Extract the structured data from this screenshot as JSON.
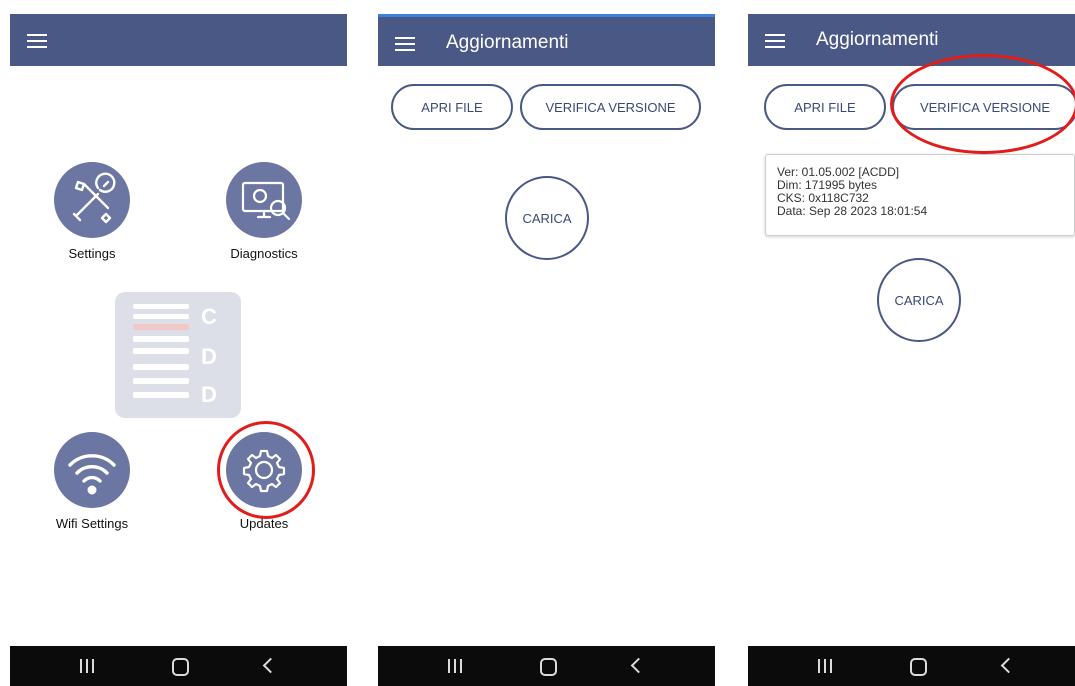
{
  "screen1": {
    "tiles": [
      {
        "label": "Settings",
        "icon": "tools-icon"
      },
      {
        "label": "Diagnostics",
        "icon": "monitor-search-icon"
      },
      {
        "label": "Wifi Settings",
        "icon": "wifi-icon"
      },
      {
        "label": "Updates",
        "icon": "gear-icon"
      }
    ],
    "logo_letters": [
      "C",
      "D",
      "D"
    ]
  },
  "screen2": {
    "title": "Aggiornamenti",
    "buttons": {
      "open_file": "APRI FILE",
      "check_version": "VERIFICA VERSIONE",
      "load": "CARICA"
    }
  },
  "screen3": {
    "title": "Aggiornamenti",
    "buttons": {
      "open_file": "APRI FILE",
      "check_version": "VERIFICA VERSIONE",
      "load": "CARICA"
    },
    "info": {
      "ver": "Ver: 01.05.002 [ACDD]",
      "dim": "Dim: 171995 bytes",
      "cks": "CKS: 0x118C732",
      "data": "Data: Sep 28 2023 18:01:54"
    }
  },
  "colors": {
    "appbar": "#4a5886",
    "icon_bg": "#6b76a3",
    "highlight": "#e21b1b",
    "navbar": "#0b0b0b"
  }
}
